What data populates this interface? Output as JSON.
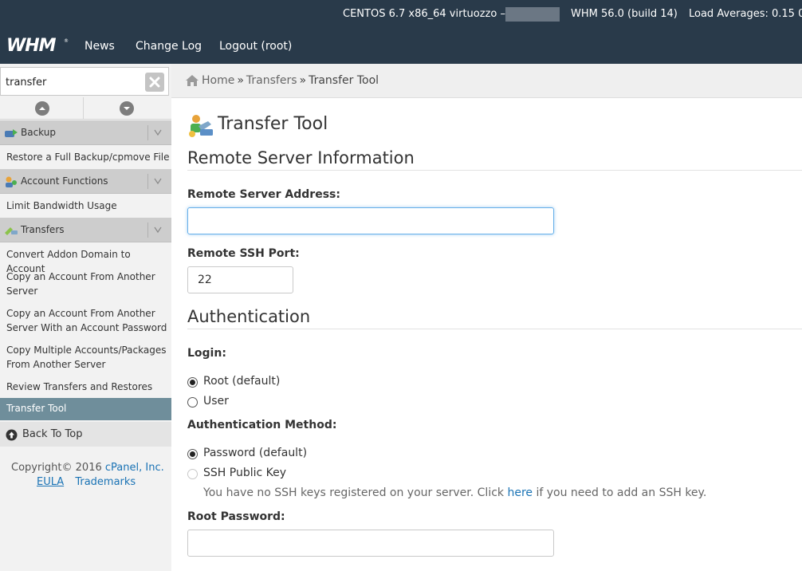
{
  "topbar": {
    "server_info": "CENTOS 6.7 x86_64 virtuozzo –",
    "whm_version": "WHM 56.0 (build 14)",
    "load_averages": "Load Averages: 0.15 0",
    "logo_text": "WHM",
    "nav": {
      "news": "News",
      "changelog": "Change Log",
      "logout": "Logout (root)"
    },
    "bg_color": "#293a4a"
  },
  "sidebar": {
    "search": {
      "value": "transfer",
      "clear_icon": "close-icon"
    },
    "categories": {
      "backup": {
        "label": "Backup",
        "icon": "backup-icon"
      },
      "account_functions": {
        "label": "Account Functions",
        "icon": "accounts-icon"
      },
      "transfers": {
        "label": "Transfers",
        "icon": "transfers-icon"
      }
    },
    "links": {
      "restore_backup": "Restore a Full Backup/cpmove File",
      "limit_bandwidth": "Limit Bandwidth Usage",
      "convert_addon": "Convert Addon Domain to Account",
      "copy_account": "Copy an Account From Another Server",
      "copy_account_password": "Copy an Account From Another Server With an Account Password",
      "copy_multiple": "Copy Multiple Accounts/Packages From Another Server",
      "review_transfers": "Review Transfers and Restores",
      "transfer_tool": "Transfer Tool"
    },
    "back_to_top": "Back To Top",
    "copyright_prefix": "Copyright© 2016",
    "copyright_brand": "cPanel, Inc.",
    "footer": {
      "eula": "EULA",
      "trademarks": "Trademarks"
    },
    "active_color": "#6f8e9b"
  },
  "breadcrumb": {
    "home": "Home",
    "sep": "»",
    "transfers": "Transfers",
    "current": "Transfer Tool"
  },
  "main": {
    "title": "Transfer Tool",
    "remote_section": "Remote Server Information",
    "remote_address_label": "Remote Server Address:",
    "remote_address_value": "",
    "ssh_port_label": "Remote SSH Port:",
    "ssh_port_value": "22",
    "auth_section": "Authentication",
    "login_label": "Login:",
    "login_options": {
      "root": "Root (default)",
      "user": "User"
    },
    "login_selected": "root",
    "method_label": "Authentication Method:",
    "method_options": {
      "password": "Password (default)",
      "ssh_key": "SSH Public Key"
    },
    "method_selected": "password",
    "ssh_help_before": "You have no SSH keys registered on your server. Click",
    "ssh_help_link": "here",
    "ssh_help_after": "if you need to add an SSH key.",
    "root_password_label": "Root Password:",
    "root_password_value": "",
    "link_color": "#1a73b5",
    "focus_color": "#66afe9"
  }
}
